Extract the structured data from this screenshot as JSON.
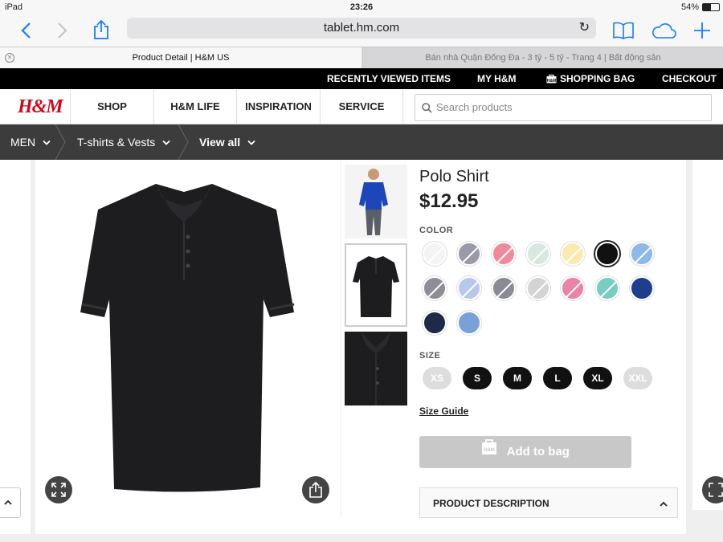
{
  "status_bar": {
    "device": "iPad",
    "time": "23:26",
    "battery": "54%"
  },
  "browser": {
    "url": "tablet.hm.com",
    "tabs": [
      {
        "label": "Product Detail | H&M US"
      },
      {
        "label": "Bán nhà Quận Đống Đa - 3 tỷ - 5 tỷ - Trang 4 | Bất động sản"
      }
    ]
  },
  "topbar": {
    "recently_viewed": "RECENTLY VIEWED ITEMS",
    "my_hm": "MY H&M",
    "shopping_bag": "SHOPPING BAG",
    "checkout": "CHECKOUT"
  },
  "nav": {
    "logo": "H&M",
    "items": [
      "SHOP",
      "H&M LIFE",
      "INSPIRATION",
      "SERVICE"
    ],
    "search_placeholder": "Search products"
  },
  "breadcrumb": [
    {
      "label": "MEN"
    },
    {
      "label": "T-shirts & Vests"
    },
    {
      "label": "View all"
    }
  ],
  "product": {
    "name": "Polo Shirt",
    "price": "$12.95",
    "color_label": "COLOR",
    "colors": [
      {
        "hex": "#f4f4f4",
        "available": false
      },
      {
        "hex": "#9a9aa6",
        "available": false
      },
      {
        "hex": "#ef8a9a",
        "available": false
      },
      {
        "hex": "#d8e8df",
        "available": false
      },
      {
        "hex": "#f9eab0",
        "available": false
      },
      {
        "hex": "#111111",
        "available": true,
        "selected": true
      },
      {
        "hex": "#8fb8e8",
        "available": false
      },
      {
        "hex": "#8e8e98",
        "available": false
      },
      {
        "hex": "#b8c8ec",
        "available": false
      },
      {
        "hex": "#8a8a96",
        "available": false
      },
      {
        "hex": "#d4d4d4",
        "available": false
      },
      {
        "hex": "#e983a8",
        "available": false
      },
      {
        "hex": "#78ccc4",
        "available": false
      },
      {
        "hex": "#1e3e8c",
        "available": true
      },
      {
        "hex": "#1e2a48",
        "available": true
      },
      {
        "hex": "#7aa0d8",
        "available": true
      }
    ],
    "size_label": "SIZE",
    "sizes": [
      {
        "label": "XS",
        "available": false
      },
      {
        "label": "S",
        "available": true
      },
      {
        "label": "M",
        "available": true
      },
      {
        "label": "L",
        "available": true
      },
      {
        "label": "XL",
        "available": true
      },
      {
        "label": "XXL",
        "available": false
      }
    ],
    "size_guide": "Size Guide",
    "add_to_bag": "Add to bag",
    "product_description": "PRODUCT DESCRIPTION"
  },
  "colors": {
    "brand_red": "#cc071e",
    "crumb_bar": "#3c3c3c",
    "ios_blue": "#1a7cf2"
  }
}
